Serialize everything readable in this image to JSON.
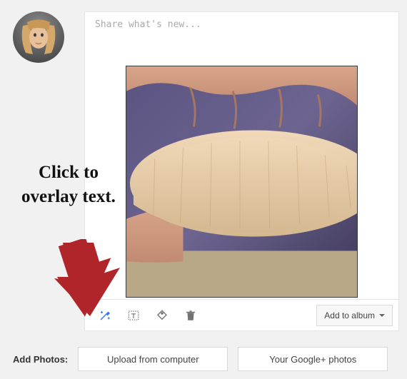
{
  "composer": {
    "placeholder": "Share what's new..."
  },
  "toolbar": {
    "album_button": "Add to album"
  },
  "add_photos": {
    "label": "Add Photos:",
    "upload_button": "Upload from computer",
    "google_photos_button": "Your Google+ photos"
  },
  "annotation": {
    "text": "Click to overlay text."
  }
}
